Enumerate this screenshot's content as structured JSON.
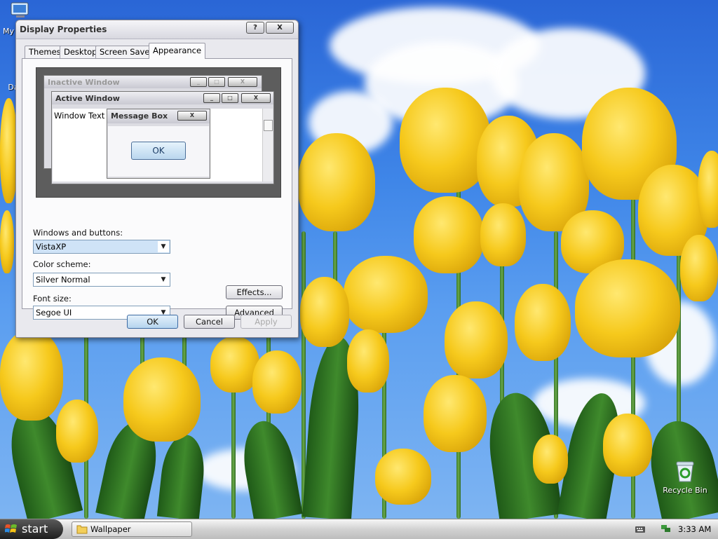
{
  "desktop": {
    "icons": [
      {
        "label": "My"
      },
      {
        "label": "Da"
      },
      {
        "label": "Recycle Bin"
      }
    ]
  },
  "dialog": {
    "title": "Display Properties",
    "help_label": "?",
    "close_label": "X",
    "tabs": [
      {
        "label": "Themes"
      },
      {
        "label": "Desktop"
      },
      {
        "label": "Screen Saver"
      },
      {
        "label": "Appearance"
      }
    ],
    "preview": {
      "inactive_title": "Inactive Window",
      "active_title": "Active Window",
      "window_text": "Window Text",
      "message_title": "Message Box",
      "ok_label": "OK"
    },
    "windows_buttons": {
      "label": "Windows and buttons:",
      "value": "VistaXP"
    },
    "color_scheme": {
      "label": "Color scheme:",
      "value": "Silver Normal"
    },
    "font_size": {
      "label": "Font size:",
      "value": "Segoe UI"
    },
    "effects_label": "Effects...",
    "advanced_label": "Advanced",
    "ok_label": "OK",
    "cancel_label": "Cancel",
    "apply_label": "Apply"
  },
  "taskbar": {
    "start_label": "start",
    "tasks": [
      {
        "label": "Wallpaper"
      }
    ],
    "clock": "3:33 AM"
  }
}
